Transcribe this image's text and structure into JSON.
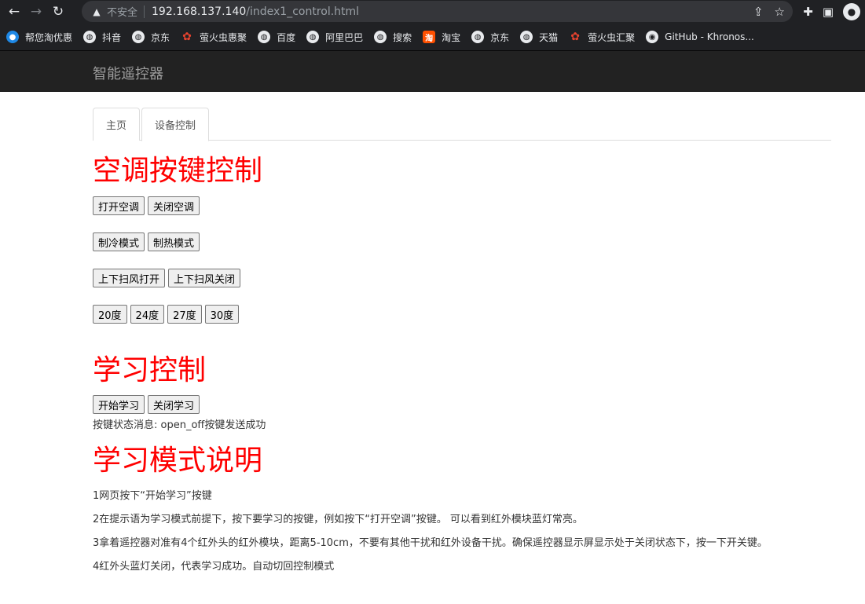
{
  "browser": {
    "insecure_label": "不安全",
    "url_host": "192.168.137.140",
    "url_path": "/index1_control.html",
    "bookmarks": [
      "帮您淘优惠",
      "抖音",
      "京东",
      "萤火虫惠聚",
      "百度",
      "阿里巴巴",
      "搜索",
      "淘宝",
      "京东",
      "天猫",
      "萤火虫汇聚",
      "GitHub - Khronos..."
    ]
  },
  "navbar": {
    "brand": "智能遥控器"
  },
  "tabs": [
    {
      "label": "主页"
    },
    {
      "label": "设备控制"
    }
  ],
  "ac_section": {
    "title": "空调按键控制",
    "power": [
      "打开空调",
      "关闭空调"
    ],
    "mode": [
      "制冷模式",
      "制热模式"
    ],
    "swing": [
      "上下扫风打开",
      "上下扫风关闭"
    ],
    "temps": [
      "20度",
      "24度",
      "27度",
      "30度"
    ]
  },
  "learn_section": {
    "title": "学习控制",
    "buttons": [
      "开始学习",
      "关闭学习"
    ],
    "status": "按键状态消息: open_off按键发送成功"
  },
  "help_section": {
    "title": "学习模式说明",
    "steps": [
      "1网页按下“开始学习”按键",
      "2在提示语为学习模式前提下，按下要学习的按键，例如按下“打开空调”按键。 可以看到红外模块蓝灯常亮。",
      "3拿着遥控器对准有4个红外头的红外模块，距离5-10cm，不要有其他干扰和红外设备干扰。确保遥控器显示屏显示处于关闭状态下，按一下开关键。",
      "4红外头蓝灯关闭，代表学习成功。自动切回控制模式"
    ]
  }
}
